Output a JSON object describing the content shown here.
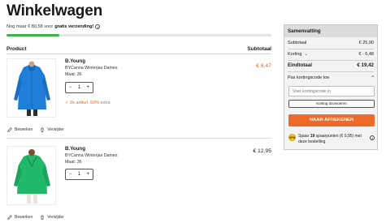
{
  "page": {
    "title": "Winkelwagen"
  },
  "shipping": {
    "prefix": "Nog maar € 80,58 voor ",
    "bold": "gratis verzending!",
    "progress_fraction": 0.2
  },
  "table": {
    "product_header": "Product",
    "subtotal_header": "Subtotaal"
  },
  "items": [
    {
      "brand": "B.Young",
      "description": "BYCanna Winterjas Dames",
      "size": "Maat: 36",
      "quantity": "1",
      "promo": "✓ 2e artikel -50% extra",
      "price": "€ 6,47",
      "edit_label": "Bewerken",
      "remove_label": "Verwijder",
      "color": "#1f7fd8"
    },
    {
      "brand": "B.Young",
      "description": "BYCanna Winterjas Dames",
      "size": "Maat: 36",
      "quantity": "1",
      "promo": "",
      "price": "€ 12,95",
      "edit_label": "Bewerken",
      "remove_label": "Verwijder",
      "color": "#22b86a"
    }
  ],
  "summary": {
    "title": "Samenvatting",
    "subtotal_label": "Subtotaal",
    "subtotal_value": "€ 25,90",
    "discount_label": "Korting",
    "discount_value": "€ - 6,48",
    "total_label": "Eindtotaal",
    "total_value": "€ 19,42",
    "coupon_toggle": "Pas kortingscode toe",
    "coupon_placeholder": "Voer kortingscode in",
    "coupon_button": "Korting doorvoeren",
    "checkout_button": "NAAR AFREKENEN",
    "loyalty_prefix": "Spaar ",
    "loyalty_points": "19",
    "loyalty_suffix": " spaarpunten (€ 0,95) met deze bestelling"
  },
  "colors": {
    "accent": "#ef6a26",
    "progress": "#3bb54a",
    "sale": "#e8661f"
  }
}
